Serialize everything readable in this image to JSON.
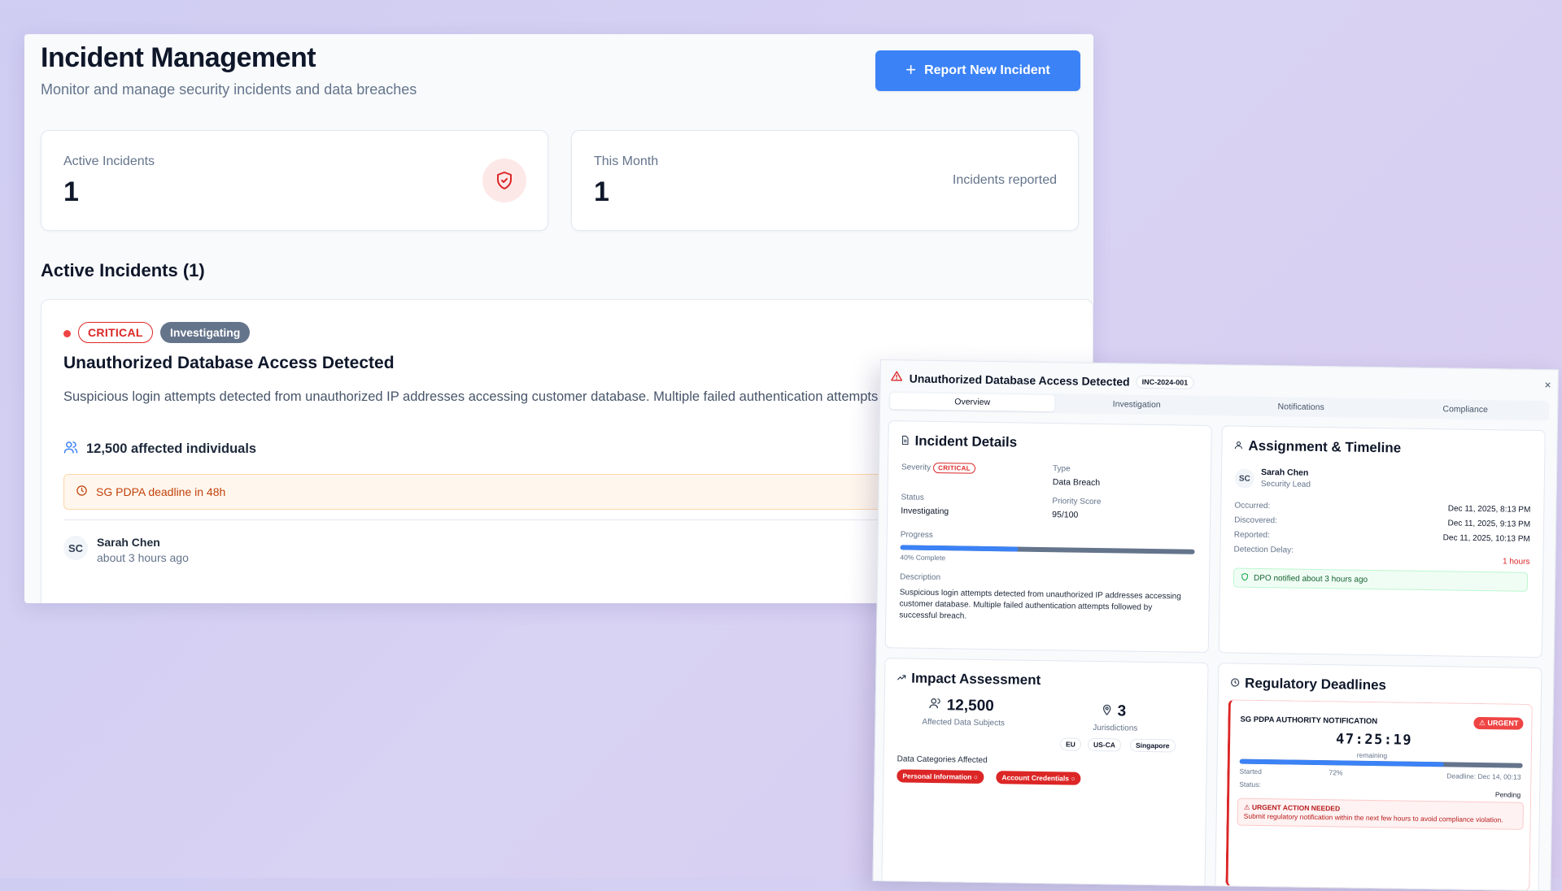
{
  "header": {
    "title": "Incident Management",
    "subtitle": "Monitor and manage security incidents and data breaches",
    "report_button": "Report New Incident"
  },
  "stats": [
    {
      "label": "Active Incidents",
      "value": "1"
    },
    {
      "label": "This Month",
      "value": "1",
      "note": "Incidents reported"
    }
  ],
  "active_section": {
    "title": "Active Incidents (1)"
  },
  "incident": {
    "severity": "CRITICAL",
    "status": "Investigating",
    "title": "Unauthorized Database Access Detected",
    "description": "Suspicious login attempts detected from unauthorized IP addresses accessing customer database. Multiple failed authentication attempts followed by successful breach.",
    "affected": "12,500 affected individuals",
    "deadline": "SG PDPA deadline in 48h",
    "reporter_initials": "SC",
    "reporter_name": "Sarah Chen",
    "reported_ago": "about 3 hours ago"
  },
  "modal": {
    "title": "Unauthorized Database Access Detected",
    "id": "INC-2024-001",
    "close": "×",
    "tabs": [
      "Overview",
      "Investigation",
      "Notifications",
      "Compliance"
    ],
    "active_tab": 0,
    "details": {
      "title": "Incident Details",
      "severity_label": "Severity",
      "severity_value": "CRITICAL",
      "type_label": "Type",
      "type_value": "Data Breach",
      "status_label": "Status",
      "status_value": "Investigating",
      "priority_label": "Priority Score",
      "priority_value": "95/100",
      "progress_label": "Progress",
      "progress_percent": 40,
      "progress_note": "40% Complete",
      "description_label": "Description",
      "description": "Suspicious login attempts detected from unauthorized IP addresses accessing customer database. Multiple failed authentication attempts followed by successful breach."
    },
    "assignment": {
      "title": "Assignment & Timeline",
      "initials": "SC",
      "name": "Sarah Chen",
      "role": "Security Lead",
      "occurred_label": "Occurred:",
      "occurred": "Dec 11, 2025, 8:13 PM",
      "discovered_label": "Discovered:",
      "discovered": "Dec 11, 2025, 9:13 PM",
      "reported_label": "Reported:",
      "reported": "Dec 11, 2025, 10:13 PM",
      "delay_label": "Detection Delay:",
      "delay": "1 hours",
      "dpo": "DPO notified about 3 hours ago"
    },
    "impact": {
      "title": "Impact Assessment",
      "subjects_value": "12,500",
      "subjects_label": "Affected Data Subjects",
      "jurisdictions_value": "3",
      "jurisdictions_label": "Jurisdictions",
      "jurisdictions": [
        "EU",
        "US-CA",
        "Singapore"
      ],
      "categories_label": "Data Categories Affected",
      "categories": [
        "Personal Information",
        "Account Credentials"
      ]
    },
    "regulatory": {
      "title": "Regulatory Deadlines",
      "authority": "SG PDPA AUTHORITY NOTIFICATION",
      "urgent": "URGENT",
      "countdown": "47:25:19",
      "remaining": "remaining",
      "progress_percent": 72,
      "started": "Started",
      "progress_label": "72%",
      "deadline": "Deadline: Dec 14, 00:13",
      "status_label": "Status:",
      "status_value": "Pending",
      "urgent_title": "URGENT ACTION NEEDED",
      "urgent_text": "Submit regulatory notification within the next few hours to avoid compliance violation."
    }
  },
  "colors": {
    "primary": "#3b82f6",
    "critical": "#dc2626",
    "status_badge": "#64748b",
    "deadline_bg": "#fff7ed"
  }
}
